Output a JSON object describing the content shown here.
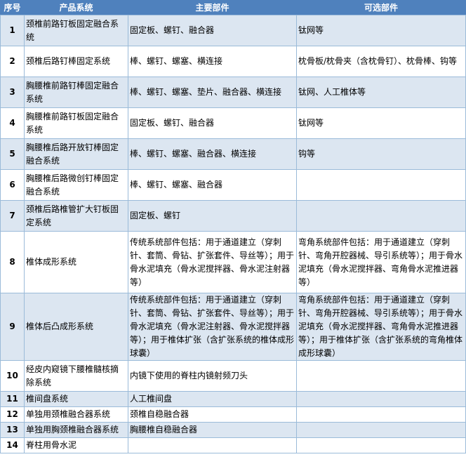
{
  "headers": [
    "序号",
    "产品系统",
    "主要部件",
    "可选部件"
  ],
  "rows": [
    {
      "no": "1",
      "system": "颈椎前路钉板固定融合系统",
      "main": "固定板、螺钉、融合器",
      "optional": "钛网等"
    },
    {
      "no": "2",
      "system": "颈椎后路钉棒固定系统",
      "main": "棒、螺钉、螺塞、横连接",
      "optional": "枕骨板/枕骨夹（含枕骨钉）、枕骨棒、钩等"
    },
    {
      "no": "3",
      "system": "胸腰椎前路钉棒固定融合系统",
      "main": "棒、螺钉、螺塞、垫片、融合器、横连接",
      "optional": "钛网、人工椎体等"
    },
    {
      "no": "4",
      "system": "胸腰椎前路钉板固定融合系统",
      "main": "固定板、螺钉、融合器",
      "optional": "钛网等"
    },
    {
      "no": "5",
      "system": "胸腰椎后路开放钉棒固定融合系统",
      "main": "棒、螺钉、螺塞、融合器、横连接",
      "optional": "钩等"
    },
    {
      "no": "6",
      "system": "胸腰椎后路微创钉棒固定融合系统",
      "main": "棒、螺钉、螺塞、融合器",
      "optional": ""
    },
    {
      "no": "7",
      "system": "颈椎后路椎管扩大钉板固定系统",
      "main": "固定板、螺钉",
      "optional": ""
    },
    {
      "no": "8",
      "system": "椎体成形系统",
      "main": "传统系统部件包括：用于通道建立（穿刺针、套筒、骨钻、扩张套件、导丝等）；用于骨水泥填充（骨水泥搅拌器、骨水泥注射器等）",
      "optional": "弯角系统部件包括：用于通道建立（穿刺针、弯角开腔器械、导引系统等）；用于骨水泥填充（骨水泥搅拌器、弯角骨水泥推进器等）"
    },
    {
      "no": "9",
      "system": "椎体后凸成形系统",
      "main": "传统系统部件包括：用于通道建立（穿刺针、套筒、骨钻、扩张套件、导丝等）；用于骨水泥填充（骨水泥注射器、骨水泥搅拌器等）；用于椎体扩张（含扩张系统的椎体成形球囊）",
      "optional": "弯角系统部件包括：用于通道建立（穿刺针、弯角开腔器械、导引系统等）；用于骨水泥填充（骨水泥搅拌器、弯角骨水泥推进器等）；用于椎体扩张（含扩张系统的弯角椎体成形球囊）"
    },
    {
      "no": "10",
      "system": "经皮内窥镜下腰椎髓核摘除系统",
      "main": "内镜下使用的脊柱内镜射频刀头",
      "optional": ""
    },
    {
      "no": "11",
      "system": "椎间盘系统",
      "main": "人工椎间盘",
      "optional": ""
    },
    {
      "no": "12",
      "system": "单独用颈椎融合器系统",
      "main": "颈椎自稳融合器",
      "optional": ""
    },
    {
      "no": "13",
      "system": "单独用胸颈椎融合器系统",
      "main": "胸腰椎自稳融合器",
      "optional": ""
    },
    {
      "no": "14",
      "system": "脊柱用骨水泥",
      "main": "",
      "optional": ""
    }
  ]
}
